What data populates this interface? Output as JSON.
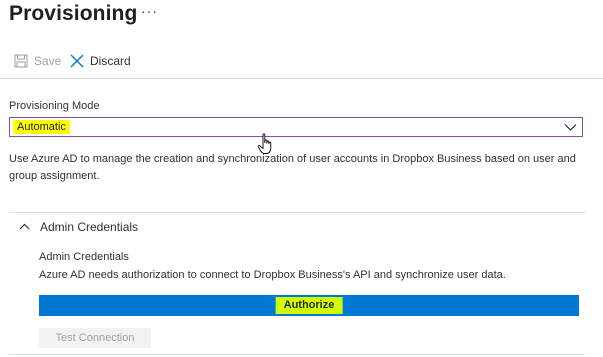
{
  "page": {
    "title": "Provisioning",
    "more_label": "···"
  },
  "toolbar": {
    "save_label": "Save",
    "discard_label": "Discard"
  },
  "provisioning_mode": {
    "label": "Provisioning Mode",
    "selected": "Automatic",
    "description": "Use Azure AD to manage the creation and synchronization of user accounts in Dropbox Business based on user and group assignment."
  },
  "admin_credentials": {
    "section_label": "Admin Credentials",
    "expanded": true,
    "title": "Admin Credentials",
    "description": "Azure AD needs authorization to connect to Dropbox Business's API and synchronize user data.",
    "authorize_label": "Authorize",
    "test_connection_label": "Test Connection"
  },
  "colors": {
    "accent": "#0078d4",
    "highlight_yellow": "#ffff00",
    "highlight_lime": "#cfff00",
    "select_border": "#8a4c9c"
  },
  "icons": [
    "save-icon",
    "discard-x-icon",
    "chevron-down-icon",
    "chevron-up-icon",
    "hand-cursor-icon"
  ]
}
